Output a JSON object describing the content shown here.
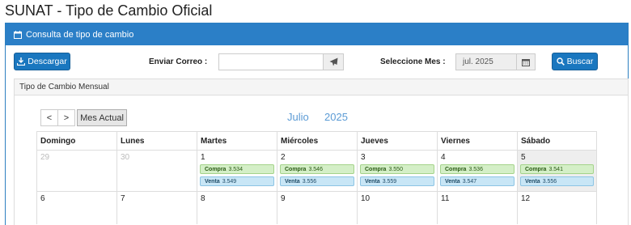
{
  "page_title": "SUNAT - Tipo de Cambio Oficial",
  "panel": {
    "title": "Consulta de tipo de cambio"
  },
  "toolbar": {
    "download_label": "Descargar",
    "email_label": "Enviar Correo :",
    "email_value": "",
    "month_label": "Seleccione Mes :",
    "month_value": "jul. 2025",
    "search_label": "Buscar"
  },
  "subpanel": {
    "title": "Tipo de Cambio Mensual"
  },
  "calendar": {
    "prev_label": "<",
    "next_label": ">",
    "current_month_label": "Mes Actual",
    "month_name": "Julio",
    "year": "2025",
    "weekdays": [
      "Domingo",
      "Lunes",
      "Martes",
      "Miércoles",
      "Jueves",
      "Viernes",
      "Sábado"
    ],
    "compra_label": "Compra",
    "venta_label": "Venta",
    "rows": [
      [
        {
          "day": "29",
          "other": true
        },
        {
          "day": "30",
          "other": true
        },
        {
          "day": "1",
          "compra": "3.534",
          "venta": "3.549"
        },
        {
          "day": "2",
          "compra": "3.546",
          "venta": "3.556"
        },
        {
          "day": "3",
          "compra": "3.550",
          "venta": "3.559"
        },
        {
          "day": "4",
          "compra": "3.536",
          "venta": "3.547"
        },
        {
          "day": "5",
          "compra": "3.541",
          "venta": "3.556",
          "today": true
        }
      ],
      [
        {
          "day": "6"
        },
        {
          "day": "7"
        },
        {
          "day": "8"
        },
        {
          "day": "9"
        },
        {
          "day": "10"
        },
        {
          "day": "11"
        },
        {
          "day": "12"
        }
      ]
    ]
  }
}
